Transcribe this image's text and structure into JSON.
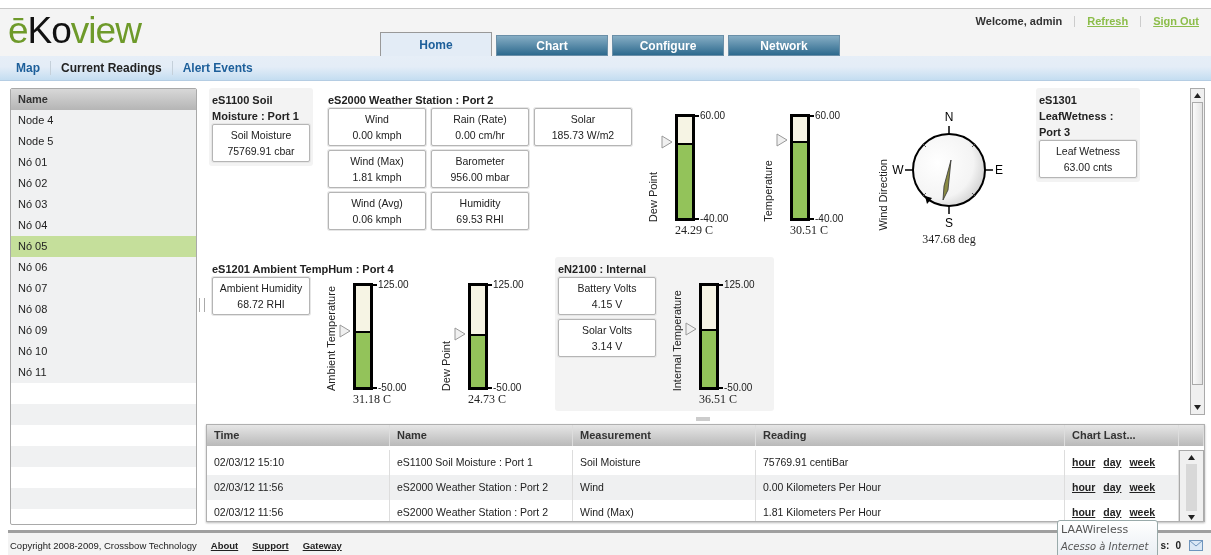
{
  "logo": [
    {
      "text": "ē",
      "color": "#6e9a2a"
    },
    {
      "text": "Ko",
      "color": "#111111"
    },
    {
      "text": "view",
      "color": "#6e9a2a"
    }
  ],
  "user_bar": {
    "welcome": "Welcome, admin",
    "links": [
      "Refresh",
      "Sign Out"
    ]
  },
  "tabs": [
    {
      "label": "Home",
      "selected": true
    },
    {
      "label": "Chart",
      "selected": false
    },
    {
      "label": "Configure",
      "selected": false
    },
    {
      "label": "Network",
      "selected": false
    }
  ],
  "subnav": [
    {
      "label": "Map",
      "selected": false
    },
    {
      "label": "Current Readings",
      "selected": true
    },
    {
      "label": "Alert Events",
      "selected": false
    }
  ],
  "node_list": {
    "header": "Name",
    "items": [
      {
        "label": "Node 4",
        "selected": false
      },
      {
        "label": "Node 5",
        "selected": false
      },
      {
        "label": "Nó 01",
        "selected": false
      },
      {
        "label": "Nó 02",
        "selected": false
      },
      {
        "label": "Nó 03",
        "selected": false
      },
      {
        "label": "Nó 04",
        "selected": false
      },
      {
        "label": "Nó 05",
        "selected": true
      },
      {
        "label": "Nó 06",
        "selected": false
      },
      {
        "label": "Nó 07",
        "selected": false
      },
      {
        "label": "Nó 08",
        "selected": false
      },
      {
        "label": "Nó 09",
        "selected": false
      },
      {
        "label": "Nó 10",
        "selected": false
      },
      {
        "label": "Nó 11",
        "selected": false
      }
    ]
  },
  "top_panels": [
    {
      "title": "eS1100 Soil Moisture : Port 1",
      "shaded": true,
      "reading_columns": [
        [
          {
            "label": "Soil Moisture",
            "value": "75769.91 cbar"
          }
        ]
      ]
    },
    {
      "title": "eS2000 Weather Station : Port 2",
      "shaded": false,
      "reading_columns": [
        [
          {
            "label": "Wind",
            "value": "0.00 kmph"
          },
          {
            "label": "Wind (Max)",
            "value": "1.81 kmph"
          },
          {
            "label": "Wind (Avg)",
            "value": "0.06 kmph"
          }
        ],
        [
          {
            "label": "Rain (Rate)",
            "value": "0.00 cm/hr"
          },
          {
            "label": "Barometer",
            "value": "956.00 mbar"
          },
          {
            "label": "Humidity",
            "value": "69.53 RHI"
          }
        ],
        [
          {
            "label": "Solar",
            "value": "185.73 W/m2"
          }
        ]
      ],
      "gauges": [
        {
          "label": "Dew Point",
          "max": "60.00",
          "min": "-40.00",
          "level": 0.74,
          "reading": "24.29 C"
        },
        {
          "label": "Temperature",
          "max": "60.00",
          "min": "-40.00",
          "level": 0.76,
          "reading": "30.51 C"
        }
      ],
      "compass": {
        "label": "Wind Direction",
        "north": "N",
        "east": "E",
        "south": "S",
        "west": "W",
        "reading": "347.68 deg"
      }
    },
    {
      "title": "eS1301 LeafWetness : Port 3",
      "shaded": true,
      "reading_columns": [
        [
          {
            "label": "Leaf Wetness",
            "value": "63.00 cnts"
          }
        ]
      ]
    }
  ],
  "bottom_panels": [
    {
      "title": "eS1201 Ambient TempHum : Port 4",
      "shaded": false,
      "reading_columns": [
        [
          {
            "label": "Ambient Humidity",
            "value": "68.72 RHI"
          }
        ]
      ],
      "gauges": [
        {
          "label": "Ambient Temperature",
          "max": "125.00",
          "min": "-50.00",
          "level": 0.55,
          "reading": "31.18 C"
        },
        {
          "label": "Dew Point",
          "max": "125.00",
          "min": "-50.00",
          "level": 0.52,
          "reading": "24.73 C"
        }
      ]
    },
    {
      "title": "eN2100 : Internal",
      "shaded": true,
      "reading_columns": [
        [
          {
            "label": "Battery Volts",
            "value": "4.15 V"
          },
          {
            "label": "Solar Volts",
            "value": "3.14 V"
          }
        ]
      ],
      "gauges": [
        {
          "label": "Internal Temperature",
          "max": "125.00",
          "min": "-50.00",
          "level": 0.57,
          "reading": "36.51 C"
        }
      ]
    }
  ],
  "readings_table": {
    "columns": [
      "Time",
      "Name",
      "Measurement",
      "Reading",
      "Chart Last..."
    ],
    "rows": [
      {
        "time": "02/03/12 15:10",
        "name": "eS1100 Soil Moisture : Port 1",
        "measurement": "Soil Moisture",
        "reading": "75769.91 centiBar",
        "links": [
          "hour",
          "day",
          "week"
        ]
      },
      {
        "time": "02/03/12 11:56",
        "name": "eS2000 Weather Station : Port 2",
        "measurement": "Wind",
        "reading": "0.00 Kilometers Per Hour",
        "links": [
          "hour",
          "day",
          "week"
        ]
      },
      {
        "time": "02/03/12 11:56",
        "name": "eS2000 Weather Station : Port 2",
        "measurement": "Wind (Max)",
        "reading": "1.81 Kilometers Per Hour",
        "links": [
          "hour",
          "day",
          "week"
        ]
      }
    ]
  },
  "footer": {
    "copyright": "Copyright 2008-2009, Crossbow Technology",
    "links": [
      "About",
      "Support",
      "Gateway"
    ],
    "status_label": "s:",
    "status_count": "0"
  },
  "tooltip": {
    "title": "LAAWireless",
    "subtitle": "Acesso à Internet"
  }
}
